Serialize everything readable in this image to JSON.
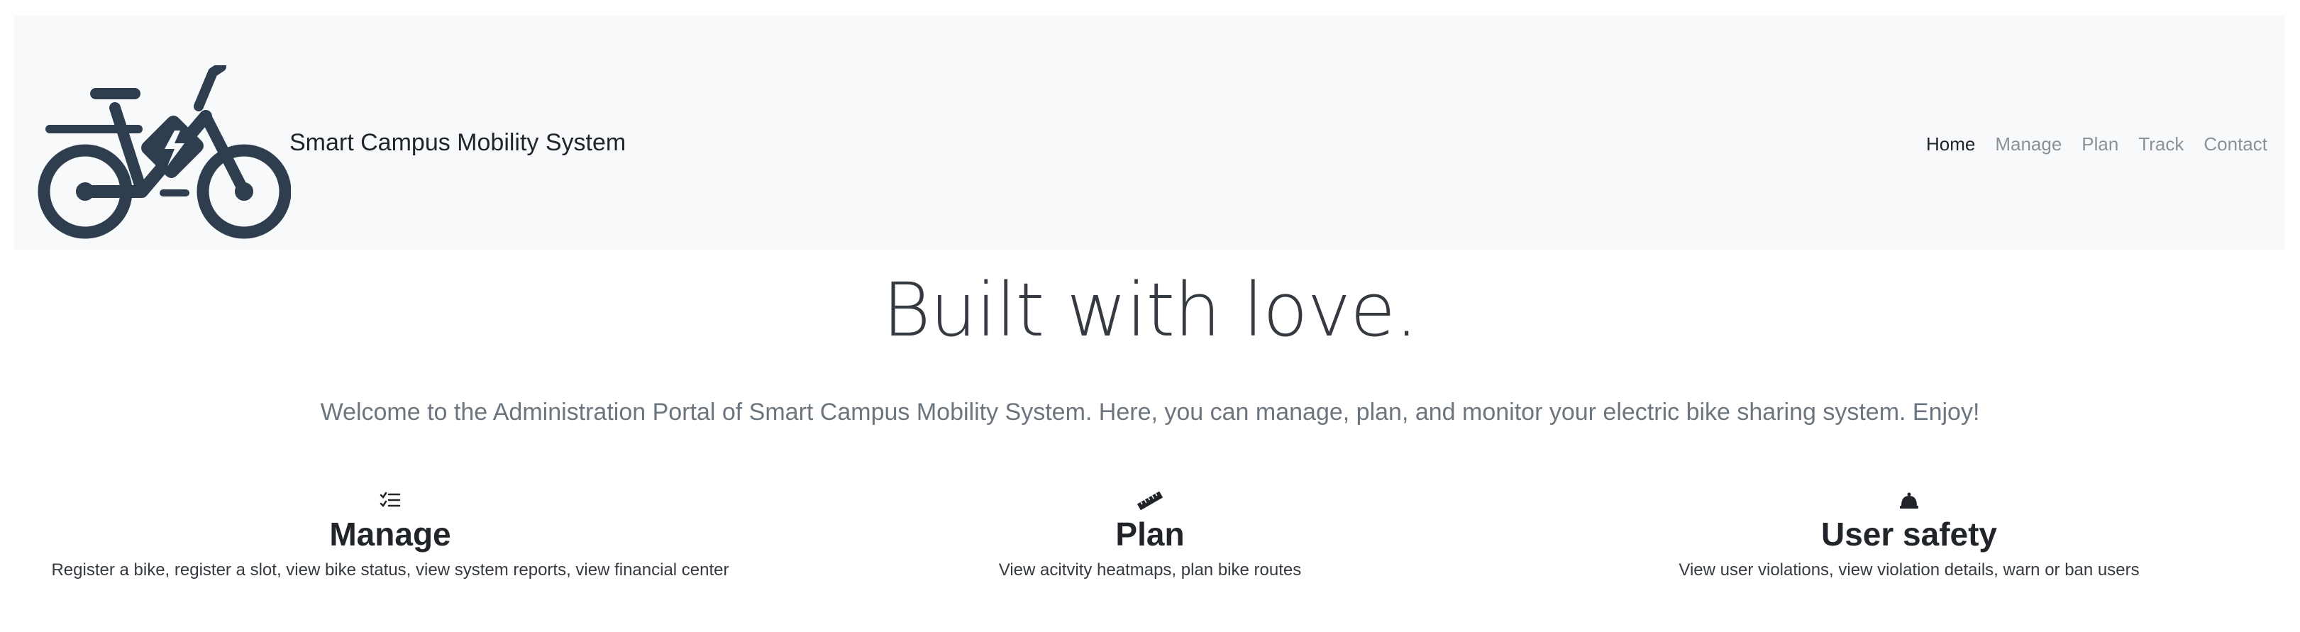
{
  "brand": {
    "title": "Smart Campus Mobility System",
    "logo_icon": "electric-bike-icon",
    "logo_color": "#2f3e4f"
  },
  "nav": {
    "items": [
      {
        "label": "Home",
        "active": true
      },
      {
        "label": "Manage",
        "active": false
      },
      {
        "label": "Plan",
        "active": false
      },
      {
        "label": "Track",
        "active": false
      },
      {
        "label": "Contact",
        "active": false
      }
    ]
  },
  "hero": {
    "title": "Built with love.",
    "lead": "Welcome to the Administration Portal of Smart Campus Mobility System. Here, you can manage, plan, and monitor your electric bike sharing system. Enjoy!"
  },
  "features": [
    {
      "icon": "checklist-icon",
      "title": "Manage",
      "description": "Register a bike, register a slot, view bike status, view system reports, view financial center"
    },
    {
      "icon": "ruler-icon",
      "title": "Plan",
      "description": "View acitvity heatmaps, plan bike routes"
    },
    {
      "icon": "bell-icon",
      "title": "User safety",
      "description": "View user violations, view violation details, warn or ban users"
    }
  ],
  "colors": {
    "navbar_bg": "#f8f9fa",
    "nav_active": "#212529",
    "nav_inactive": "#8c9196"
  }
}
